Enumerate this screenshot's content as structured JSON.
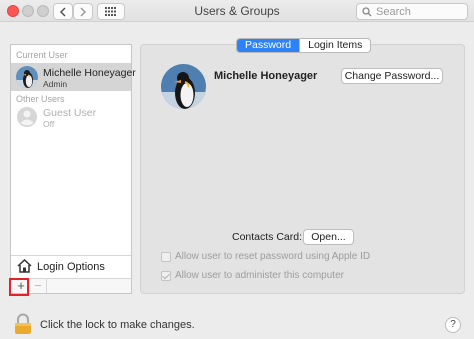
{
  "window": {
    "title": "Users & Groups"
  },
  "toolbar": {
    "back_icon": "chevron-left-icon",
    "forward_icon": "chevron-right-icon",
    "grid_icon": "show-all-grid-icon",
    "search_placeholder": "Search"
  },
  "sidebar": {
    "current_user_label": "Current User",
    "other_users_label": "Other Users",
    "users": [
      {
        "name": "Michelle Honeyager",
        "role": "Admin",
        "selected": true
      },
      {
        "name": "Guest User",
        "role": "Off",
        "selected": false
      }
    ],
    "login_options_label": "Login Options",
    "add_symbol": "+",
    "remove_symbol": "−"
  },
  "main": {
    "tabs": [
      {
        "label": "Password",
        "active": true
      },
      {
        "label": "Login Items",
        "active": false
      }
    ],
    "user_full_name": "Michelle Honeyager",
    "change_password_label": "Change Password...",
    "contacts_card_label": "Contacts Card:",
    "open_label": "Open...",
    "checkboxes": [
      {
        "label": "Allow user to reset password using Apple ID",
        "checked": false
      },
      {
        "label": "Allow user to administer this computer",
        "checked": true
      }
    ]
  },
  "footer": {
    "lock_text": "Click the lock to make changes.",
    "help_symbol": "?"
  },
  "colors": {
    "accent": "#2d82f7",
    "close": "#fc5753",
    "highlight": "#e0242a"
  }
}
